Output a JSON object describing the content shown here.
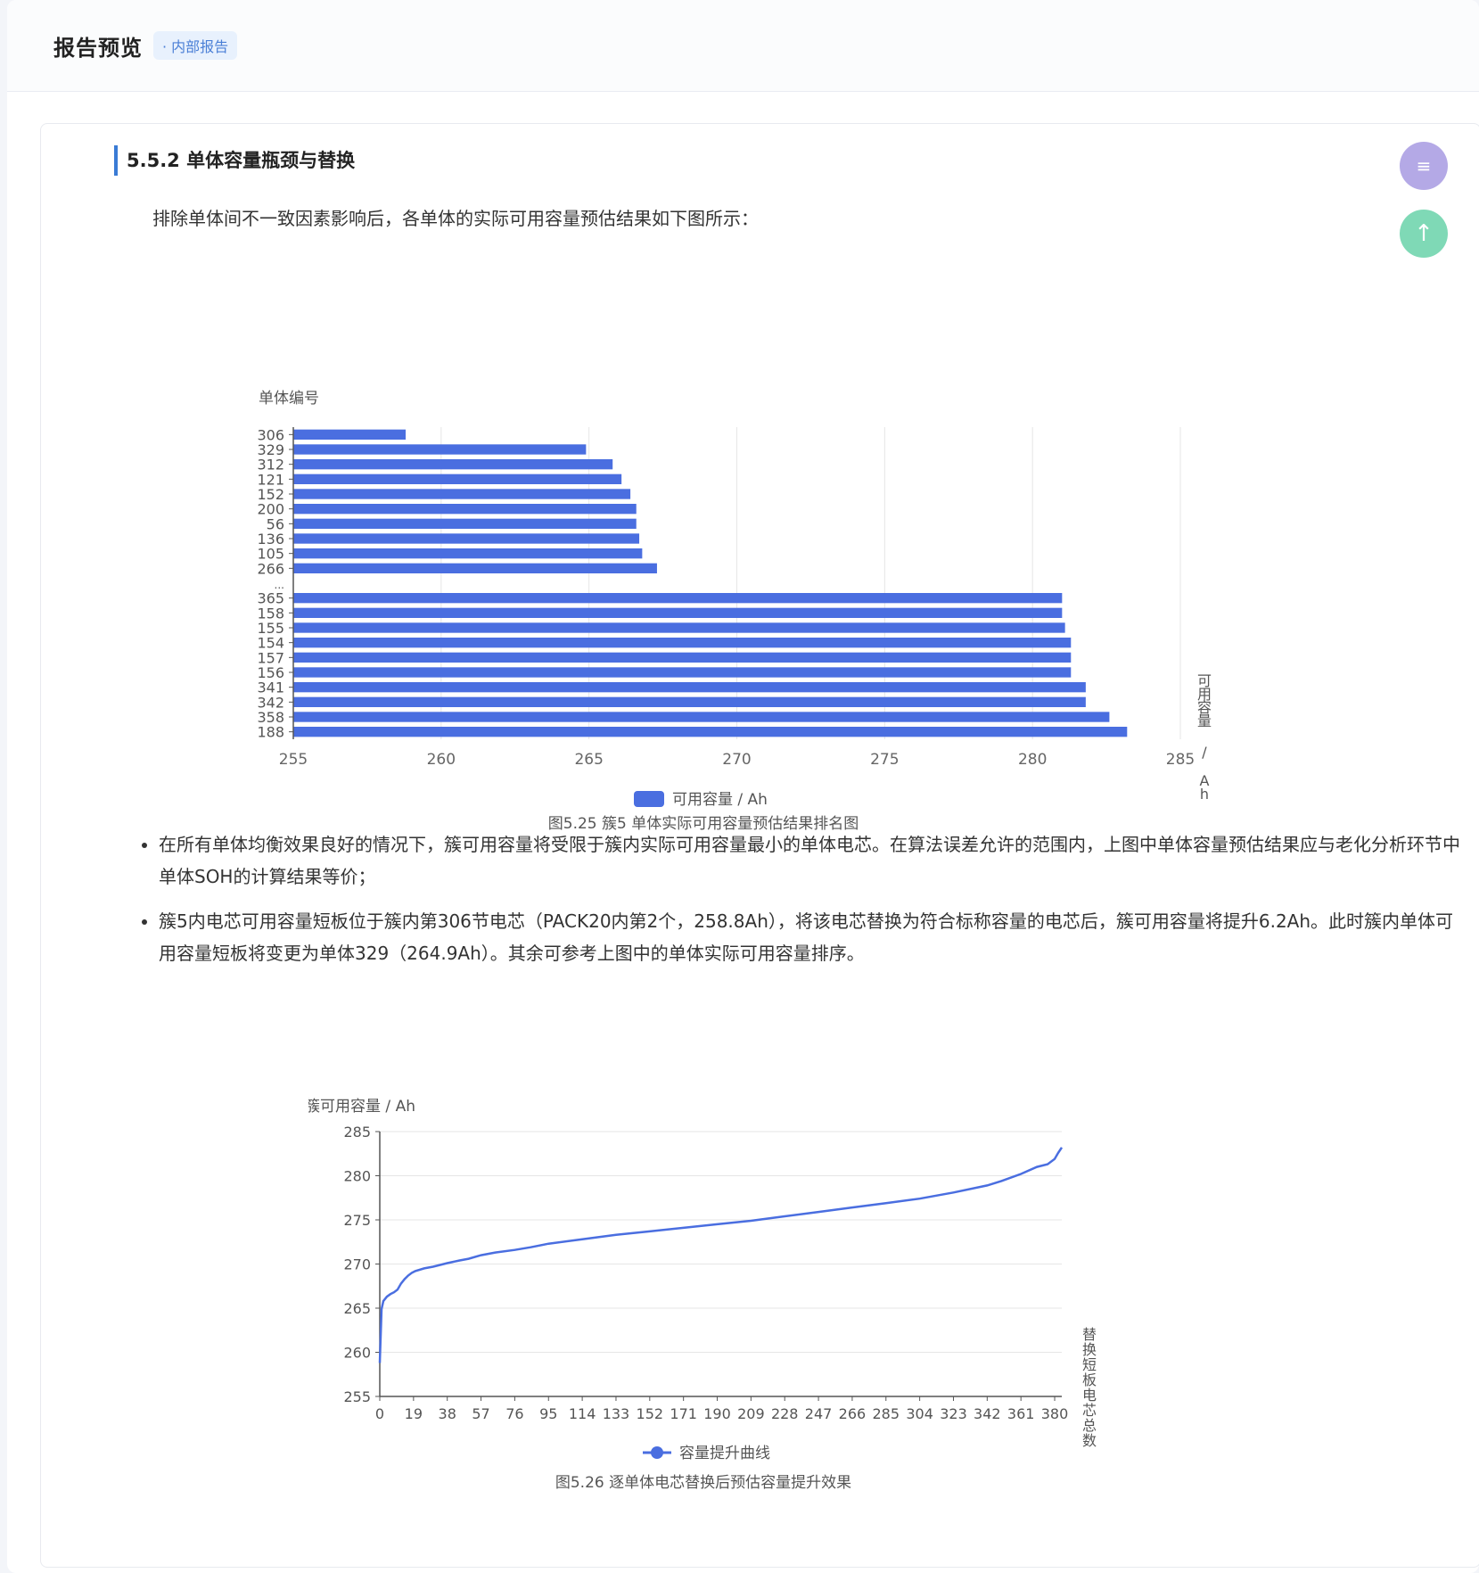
{
  "header": {
    "title": "报告预览",
    "badge": "· 内部报告"
  },
  "section": {
    "title": "5.5.2 单体容量瓶颈与替换",
    "intro": "排除单体间不一致因素影响后，各单体的实际可用容量预估结果如下图所示："
  },
  "buttons": {
    "menu_icon": "≡",
    "top_icon": "↑"
  },
  "colors": {
    "bar": "#4a6ee0",
    "line": "#4a6ee0",
    "accent": "#3a7bd5"
  },
  "chart_data": [
    {
      "type": "bar",
      "orientation": "horizontal",
      "ylabel": "单体编号",
      "xlabel": "可用容量 / Ah",
      "legend": "可用容量 / Ah",
      "caption": "图5.25 簇5 单体实际可用容量预估结果排名图",
      "xlim": [
        255,
        285
      ],
      "xticks": [
        "255",
        "260",
        "265",
        "270",
        "275",
        "280",
        "285"
      ],
      "ellipsis_label": "...",
      "categories": [
        "306",
        "329",
        "312",
        "121",
        "152",
        "200",
        "56",
        "136",
        "105",
        "266",
        "...",
        "365",
        "158",
        "155",
        "154",
        "157",
        "156",
        "341",
        "342",
        "358",
        "188"
      ],
      "values": [
        258.8,
        264.9,
        265.8,
        266.1,
        266.4,
        266.6,
        266.6,
        266.7,
        266.8,
        267.3,
        null,
        281.0,
        281.0,
        281.1,
        281.3,
        281.3,
        281.3,
        281.8,
        281.8,
        282.6,
        283.2
      ]
    },
    {
      "type": "line",
      "xlabel": "替换短板电芯总数",
      "ylabel": "簇可用容量 / Ah",
      "legend": "容量提升曲线",
      "caption": "图5.26 逐单体电芯替换后预估容量提升效果",
      "ylim": [
        255,
        285
      ],
      "xlim": [
        0,
        384
      ],
      "yticks": [
        "255",
        "260",
        "265",
        "270",
        "275",
        "280",
        "285"
      ],
      "xticks": [
        "0",
        "19",
        "38",
        "57",
        "76",
        "95",
        "114",
        "133",
        "152",
        "171",
        "190",
        "209",
        "228",
        "247",
        "266",
        "285",
        "304",
        "323",
        "342",
        "361",
        "380"
      ],
      "x": [
        0,
        1,
        2,
        4,
        6,
        8,
        10,
        12,
        14,
        16,
        18,
        20,
        25,
        30,
        38,
        45,
        50,
        57,
        65,
        76,
        85,
        95,
        114,
        133,
        152,
        171,
        190,
        209,
        228,
        247,
        266,
        285,
        304,
        323,
        342,
        350,
        361,
        370,
        376,
        380,
        382,
        384
      ],
      "y": [
        258.8,
        264.9,
        265.8,
        266.3,
        266.6,
        266.8,
        267.1,
        267.8,
        268.3,
        268.7,
        269.0,
        269.2,
        269.5,
        269.7,
        270.1,
        270.4,
        270.6,
        271.0,
        271.3,
        271.6,
        271.9,
        272.3,
        272.8,
        273.3,
        273.7,
        274.1,
        274.5,
        274.9,
        275.4,
        275.9,
        276.4,
        276.9,
        277.4,
        278.1,
        278.9,
        279.4,
        280.2,
        281.0,
        281.3,
        281.9,
        282.6,
        283.2
      ]
    }
  ],
  "bullets": [
    "在所有单体均衡效果良好的情况下，簇可用容量将受限于簇内实际可用容量最小的单体电芯。在算法误差允许的范围内，上图中单体容量预估结果应与老化分析环节中单体SOH的计算结果等价；",
    "簇5内电芯可用容量短板位于簇内第306节电芯（PACK20内第2个，258.8Ah），将该电芯替换为符合标称容量的电芯后，簇可用容量将提升6.2Ah。此时簇内单体可用容量短板将变更为单体329（264.9Ah）。其余可参考上图中的单体实际可用容量排序。"
  ]
}
